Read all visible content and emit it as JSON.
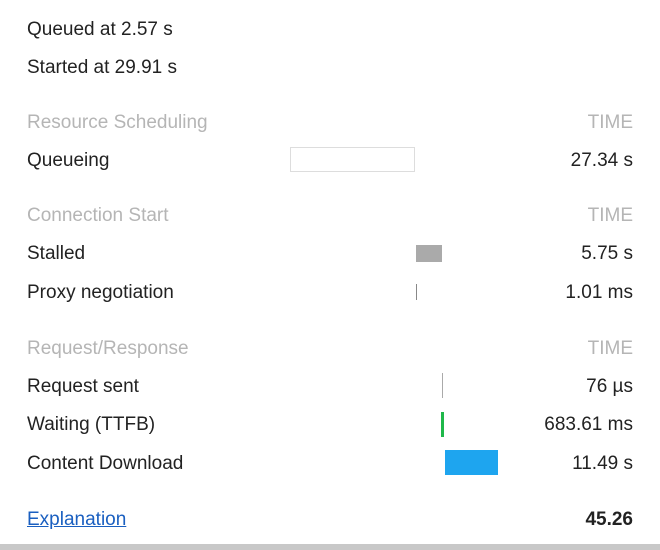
{
  "queued_at": "Queued at 2.57 s",
  "started_at": "Started at 29.91 s",
  "sections": [
    {
      "title": "Resource Scheduling",
      "time_header": "TIME",
      "rows": [
        {
          "label": "Queueing",
          "value": "27.34 s"
        }
      ]
    },
    {
      "title": "Connection Start",
      "time_header": "TIME",
      "rows": [
        {
          "label": "Stalled",
          "value": "5.75 s"
        },
        {
          "label": "Proxy negotiation",
          "value": "1.01 ms"
        }
      ]
    },
    {
      "title": "Request/Response",
      "time_header": "TIME",
      "rows": [
        {
          "label": "Request sent",
          "value": "76 µs"
        },
        {
          "label": "Waiting (TTFB)",
          "value": "683.61 ms"
        },
        {
          "label": "Content Download",
          "value": "11.49 s"
        }
      ]
    }
  ],
  "explanation_link": "Explanation",
  "total": "45.26",
  "colors": {
    "queueing": "#ffffff",
    "stalled": "#aaaaaa",
    "proxy": "#888888",
    "request": "#aaaaaa",
    "waiting": "#1fb84a",
    "download": "#1ea5ef",
    "link": "#1a5fc0"
  }
}
